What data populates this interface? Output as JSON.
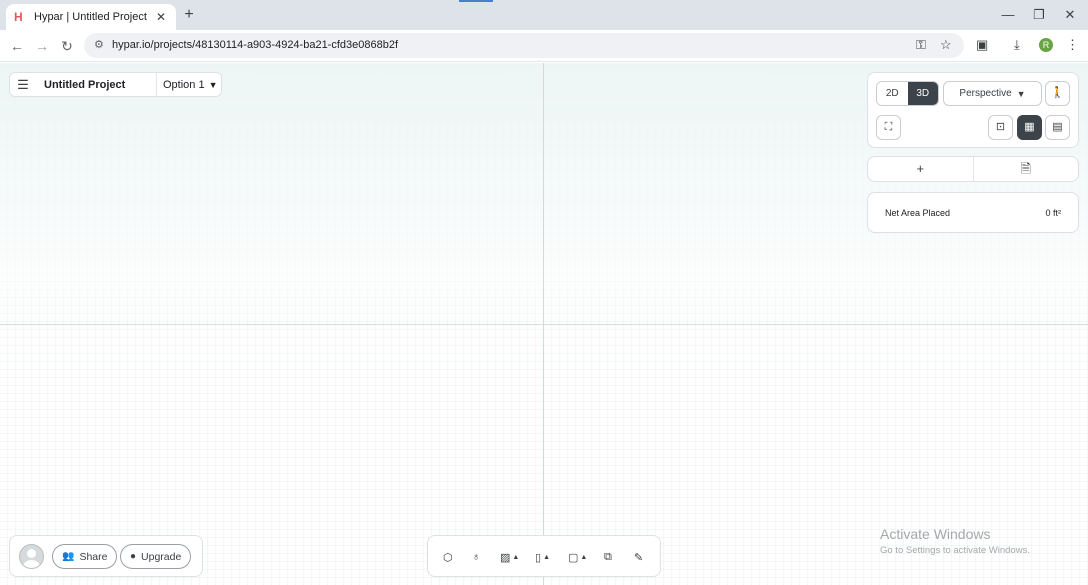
{
  "browser": {
    "tab_title": "Hypar | Untitled Project",
    "tab_favicon": "H",
    "tab_close": "✕",
    "new_tab": "+",
    "url": "hypar.io/projects/48130114-a903-4924-ba21-cfd3e0868b2f",
    "profile_initial": "R",
    "window_controls": {
      "minimize": "—",
      "maximize": "❐",
      "close": "✕"
    }
  },
  "project": {
    "name": "Untitled Project",
    "option": "Option 1"
  },
  "view": {
    "mode_2d": "2D",
    "mode_3d": "3D",
    "active_mode": "3D",
    "projection": "Perspective"
  },
  "add_panel": {
    "add_label": "+"
  },
  "metrics": {
    "net_area_label": "Net Area Placed",
    "net_area_value": "0 ft²"
  },
  "footer": {
    "share_label": "Share",
    "upgrade_label": "Upgrade"
  },
  "watermark": {
    "line1": "Activate Windows",
    "line2": "Go to Settings to activate Windows."
  },
  "colors": {
    "accent_dark": "#3d434a",
    "favicon": "#e4575f",
    "profile": "#69a443"
  }
}
